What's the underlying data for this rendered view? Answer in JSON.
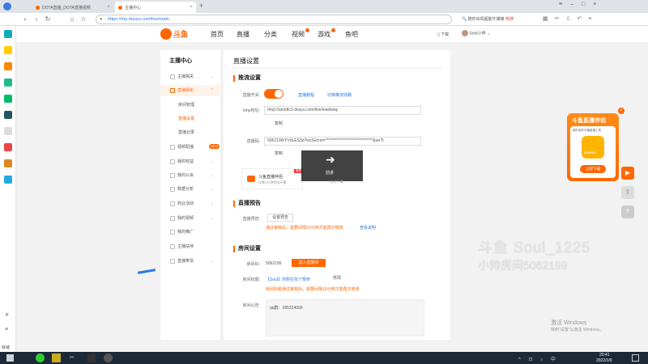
{
  "browser": {
    "tabs": [
      {
        "label": "DOTA直播_DOTA直播视频"
      },
      {
        "label": "主播中心"
      }
    ],
    "url": "https://mp.douyu.com/live/main",
    "search_placeholder": "陪你出现超能牛爆痛",
    "search_hot": "热搜"
  },
  "site": {
    "logo_text": "斗鱼",
    "logo_sub": "douyu.com",
    "nav": [
      "首页",
      "直播",
      "分类",
      "视频",
      "游戏",
      "鱼吧"
    ],
    "download": "下载",
    "user": "SouI小帅"
  },
  "menu": {
    "title": "主播中心",
    "items": [
      {
        "label": "主播相关",
        "arrow": "⌄"
      },
      {
        "label": "直播相关",
        "arrow": "⌃",
        "active": true
      },
      {
        "label": "房间管理",
        "sub": true
      },
      {
        "label": "直播设置",
        "sub": true,
        "selected": true
      },
      {
        "label": "直播记录",
        "sub": true
      },
      {
        "label": "视频配播",
        "arrow": "⌄",
        "badge": "NEW"
      },
      {
        "label": "我的权益",
        "arrow": "⌄"
      },
      {
        "label": "我的公会",
        "arrow": "⌄"
      },
      {
        "label": "数据分析",
        "arrow": "⌄"
      },
      {
        "label": "商业活动",
        "arrow": "⌄"
      },
      {
        "label": "我的视频",
        "arrow": "⌄"
      },
      {
        "label": "我的推广",
        "arrow": ""
      },
      {
        "label": "主播扶持",
        "arrow": ""
      },
      {
        "label": "直播带货",
        "arrow": "⌄"
      }
    ]
  },
  "main": {
    "title": "直播设置",
    "push": {
      "heading": "推流设置",
      "switch_label": "直播开关:",
      "tutorial": "直播教程",
      "switch_line": "切换推流线路",
      "rtmp_label": "rtmp地址:",
      "rtmp_value": "rtmp://sendtc3.douyu.com/live/lowdelay",
      "copy": "复制",
      "code_label": "直播码:",
      "code_value": "5062199rYVdLES3p?wsSecret=******************************&wsTi",
      "copy2": "复制",
      "companion_title": "斗鱼直播伴侣",
      "companion_sub": "仅需1分钟完成开播",
      "companion_badge": "推荐",
      "overlay_text": "前进",
      "overlay_sub": "前往下载"
    },
    "preview": {
      "heading": "直播预告",
      "label": "直播预告:",
      "set_btn": "设置预告",
      "warn": "通过审核后，需要间隔10分钟才能再次修改",
      "view_link": "查看说明"
    },
    "room": {
      "heading": "房间设置",
      "id_label": "房间ID:",
      "id_value": "5062199",
      "enter_btn": "进入直播间",
      "title_label": "房间标题:",
      "title_value": "【Soul】你刚在找个孽命",
      "edit_btn": "修改",
      "title_warn": "房间标题通过审核后，需要间隔10分钟才能再次修改",
      "notice_label": "房间公告:",
      "notice_value": "qq群：285324099"
    }
  },
  "ad": {
    "title": "斗鱼直播伴侣",
    "sub": "超好用的开播直播工具",
    "btn": "立即下载",
    "brand": "DOUYU"
  },
  "watermark": {
    "line1": "斗鱼 Soul_1225",
    "line2": "小帅房间5062199",
    "win1": "激活 Windows",
    "win2": "转到\"设置\"以激活 Windows。"
  },
  "taskbar": {
    "time": "20:41",
    "date": "2022/1/9",
    "left_label": "就绪"
  },
  "colors": {
    "accent": "#ff6a00",
    "link": "#2a7ae2"
  }
}
